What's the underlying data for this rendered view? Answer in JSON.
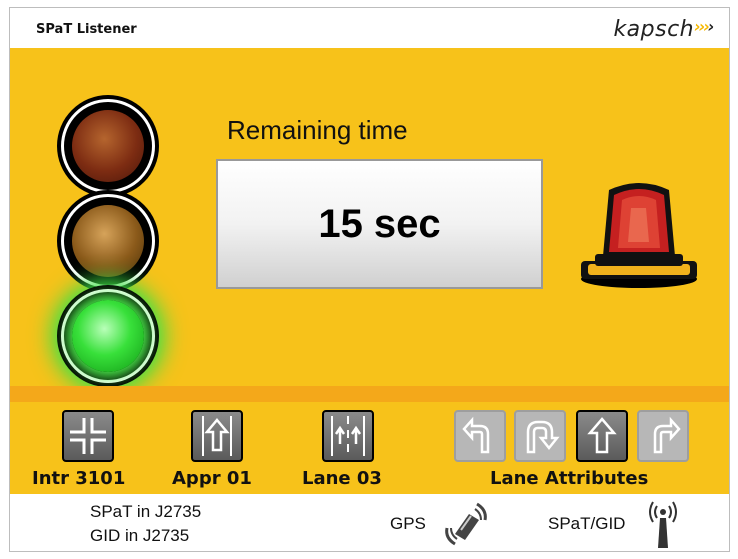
{
  "window": {
    "title": "SPaT Listener",
    "brand": "kapsch",
    "brand_mark": ">>>"
  },
  "signal": {
    "state": "green",
    "colors": {
      "red": "#7d2c12",
      "amber": "#8b5a1a",
      "green": "#38e03a"
    }
  },
  "remaining": {
    "label": "Remaining time",
    "value": "15 sec"
  },
  "alert_beacon": {
    "icon": "rotating-beacon-icon",
    "active": true,
    "color": "#d62020"
  },
  "identifiers": {
    "intersection_label": "Intr 3101",
    "approach_label": "Appr 01",
    "lane_label": "Lane 03",
    "lane_attributes_title": "Lane Attributes"
  },
  "lane_attributes": [
    {
      "icon": "turn-left-arrow-icon",
      "active": false
    },
    {
      "icon": "u-turn-arrow-icon",
      "active": false
    },
    {
      "icon": "straight-arrow-icon",
      "active": true
    },
    {
      "icon": "turn-right-arrow-icon",
      "active": false
    }
  ],
  "status": {
    "spat_format": "SPaT in J2735",
    "gid_format": "GID in J2735",
    "gps_label": "GPS",
    "spat_gid_label": "SPaT/GID"
  },
  "colors": {
    "background_yellow": "#f7c21a",
    "band_orange": "#f4a81a"
  }
}
